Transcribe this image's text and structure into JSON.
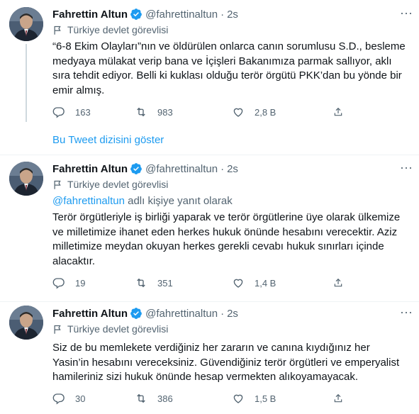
{
  "tweets": [
    {
      "name": "Fahrettin Altun",
      "handle": "@fahrettinaltun",
      "separator": "·",
      "time": "2s",
      "label": "Türkiye devlet görevlisi",
      "replying_prefix": "",
      "replying_mention": "",
      "replying_suffix": "",
      "text": "“6-8 Ekim Olayları”nın ve öldürülen onlarca canın sorumlusu S.D., besleme medyaya mülakat verip bana ve İçişleri Bakanımıza parmak sallıyor, aklı sıra tehdit ediyor. Belli ki kuklası olduğu terör örgütü PKK’dan bu yönde bir emir almış.",
      "replies": "163",
      "retweets": "983",
      "likes": "2,8 B"
    },
    {
      "name": "Fahrettin Altun",
      "handle": "@fahrettinaltun",
      "separator": "·",
      "time": "2s",
      "label": "Türkiye devlet görevlisi",
      "replying_prefix": "",
      "replying_mention": "@fahrettinaltun",
      "replying_suffix": " adlı kişiye yanıt olarak",
      "text": "Terör örgütleriyle iş birliği yaparak ve terör örgütlerine üye olarak ülkemize ve milletimize ihanet eden herkes hukuk önünde hesabını verecektir. Aziz milletimize meydan okuyan herkes gerekli cevabı hukuk sınırları içinde alacaktır.",
      "replies": "19",
      "retweets": "351",
      "likes": "1,4 B"
    },
    {
      "name": "Fahrettin Altun",
      "handle": "@fahrettinaltun",
      "separator": "·",
      "time": "2s",
      "label": "Türkiye devlet görevlisi",
      "replying_prefix": "",
      "replying_mention": "",
      "replying_suffix": "",
      "text": "Siz de bu memlekete verdiğiniz her zararın ve canına kıydığınız her Yasin’in hesabını vereceksiniz. Güvendiğiniz terör örgütleri ve emperyalist hamileriniz sizi hukuk önünde hesap vermekten alıkoyamayacak.",
      "replies": "30",
      "retweets": "386",
      "likes": "1,5 B"
    }
  ],
  "show_thread_label": "Bu Tweet dizisini göster",
  "more_symbol": "···",
  "icons": {
    "verified": "verified-badge-icon",
    "label": "flag-icon",
    "reply": "reply-icon",
    "retweet": "retweet-icon",
    "like": "heart-icon",
    "share": "share-icon",
    "more": "more-icon"
  },
  "colors": {
    "accent": "#1d9bf0",
    "text": "#0f1419",
    "secondary": "#536471",
    "thread_line": "#cfd9de"
  }
}
